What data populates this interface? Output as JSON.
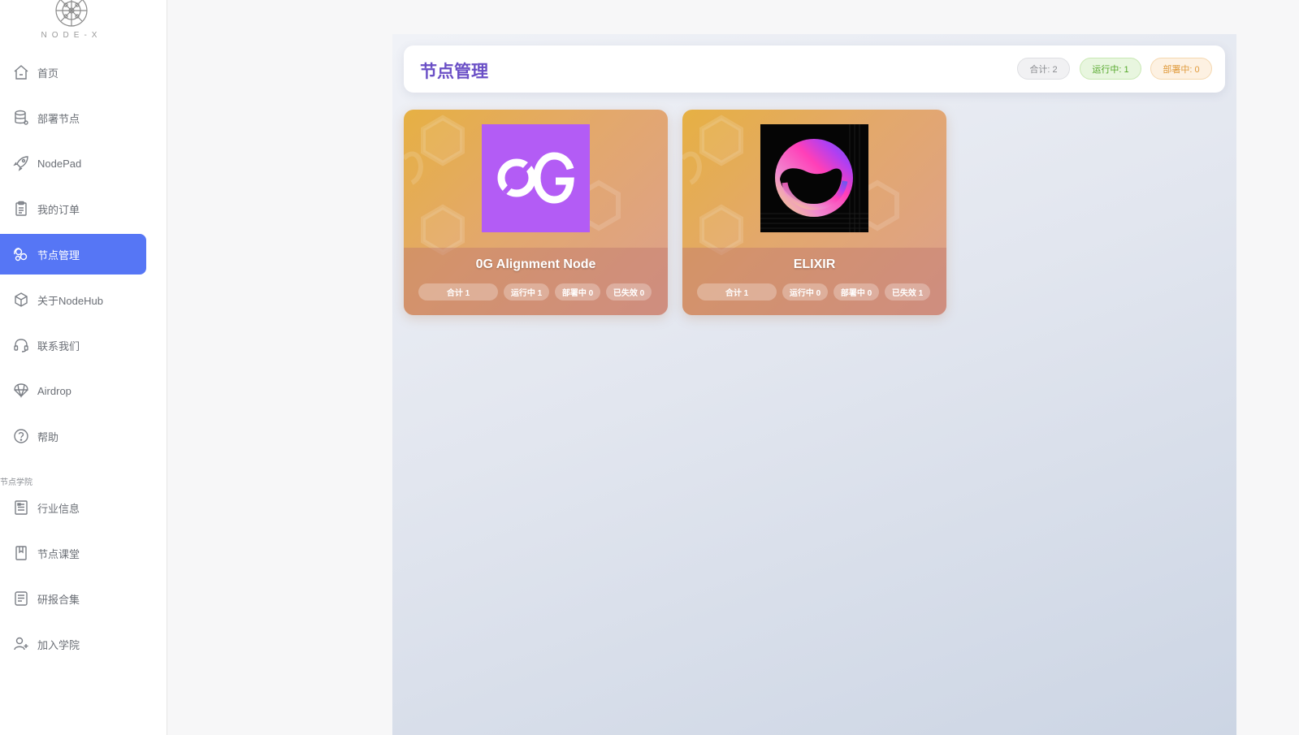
{
  "brand": {
    "logo_text": "NODE-X"
  },
  "sidebar": {
    "items": [
      {
        "label": "首页",
        "icon": "home-icon"
      },
      {
        "label": "部署节点",
        "icon": "database-icon"
      },
      {
        "label": "NodePad",
        "icon": "rocket-icon"
      },
      {
        "label": "我的订单",
        "icon": "clipboard-icon"
      },
      {
        "label": "节点管理",
        "icon": "cluster-icon",
        "active": true
      },
      {
        "label": "关于NodeHub",
        "icon": "box-icon"
      },
      {
        "label": "联系我们",
        "icon": "headset-icon"
      },
      {
        "label": "Airdrop",
        "icon": "parachute-icon"
      },
      {
        "label": "帮助",
        "icon": "help-icon"
      }
    ],
    "section_title": "节点学院",
    "academy_items": [
      {
        "label": "行业信息",
        "icon": "news-icon"
      },
      {
        "label": "节点课堂",
        "icon": "book-icon"
      },
      {
        "label": "研报合集",
        "icon": "report-icon"
      },
      {
        "label": "加入学院",
        "icon": "user-add-icon"
      }
    ]
  },
  "header": {
    "title": "节点管理",
    "badges": {
      "total": "合计: 2",
      "running": "运行中: 1",
      "deploying": "部署中: 0"
    }
  },
  "nodes": [
    {
      "name": "0G Alignment Node",
      "logo_text": "0G",
      "logo_bg": "#b35cf5",
      "pills": [
        "合计 1",
        "运行中 1",
        "部署中 0",
        "已失效 0"
      ]
    },
    {
      "name": "ELIXIR",
      "logo_bg": "#050505",
      "pills": [
        "合计 1",
        "运行中 0",
        "部署中 0",
        "已失效 1"
      ]
    }
  ],
  "colors": {
    "accent": "#5676f5",
    "title": "#6a4fc6",
    "card_gradient_start": "#e6b043",
    "card_gradient_end": "#dca08e"
  }
}
